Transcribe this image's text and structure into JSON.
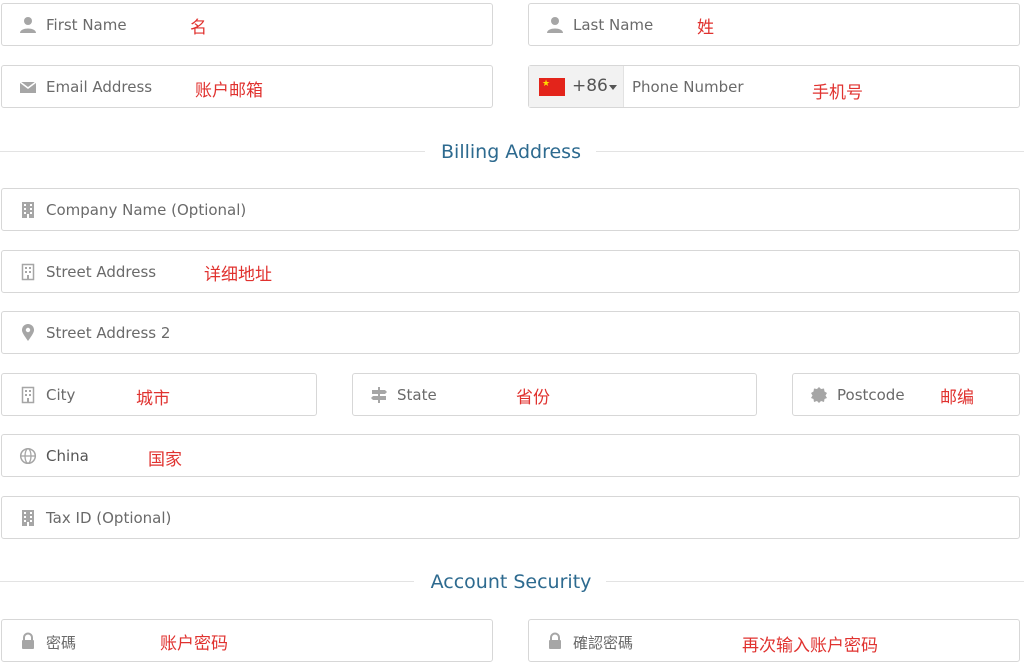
{
  "personal": {
    "first_name": {
      "placeholder": "First Name",
      "note": "名"
    },
    "last_name": {
      "placeholder": "Last Name",
      "note": "姓"
    },
    "email": {
      "placeholder": "Email Address",
      "note": "账户邮箱"
    },
    "phone": {
      "dial_code": "+86",
      "placeholder": "Phone Number",
      "note": "手机号",
      "flag": "china-flag"
    }
  },
  "billing": {
    "section_title": "Billing Address",
    "company": {
      "placeholder": "Company Name (Optional)"
    },
    "street": {
      "placeholder": "Street Address",
      "note": "详细地址"
    },
    "street2": {
      "placeholder": "Street Address 2"
    },
    "city": {
      "placeholder": "City",
      "note": "城市"
    },
    "state": {
      "placeholder": "State",
      "note": "省份"
    },
    "postcode": {
      "placeholder": "Postcode",
      "note": "邮编"
    },
    "country": {
      "value": "China",
      "note": "国家"
    },
    "tax_id": {
      "placeholder": "Tax ID (Optional)"
    }
  },
  "security": {
    "section_title": "Account Security",
    "password": {
      "placeholder": "密碼",
      "note": "账户密码"
    },
    "confirm_password": {
      "placeholder": "確認密碼",
      "note": "再次输入账户密码"
    }
  },
  "colors": {
    "section_title": "#2d6a8f",
    "note": "#e0322f",
    "icon": "#a6a6a6",
    "border": "#d7d7d7"
  }
}
